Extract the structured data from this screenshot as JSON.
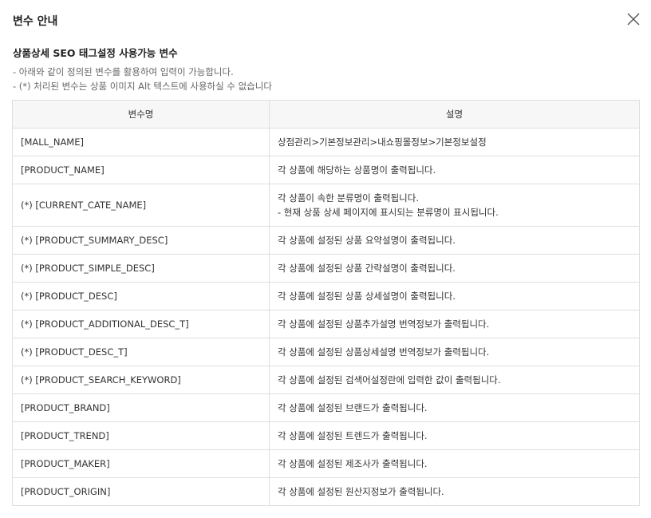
{
  "dialog": {
    "title": "변수 안내",
    "close_label": "닫기"
  },
  "section": {
    "title": "상품상세 SEO 태그설정 사용가능 변수",
    "notes": [
      "- 아래와 같이 정의된 변수를 활용하여 입력이 가능합니다.",
      "- (*) 처리된 변수는 상품 이미지 Alt 텍스트에 사용하실 수 없습니다"
    ]
  },
  "table": {
    "headers": [
      "변수명",
      "설명"
    ],
    "rows": [
      {
        "name": "[MALL_NAME]",
        "desc": [
          "상점관리>기본정보관리>내쇼핑몰정보>기본정보설정"
        ]
      },
      {
        "name": "[PRODUCT_NAME]",
        "desc": [
          "각 상품에 해당하는 상품명이 출력됩니다."
        ]
      },
      {
        "name": "(*) [CURRENT_CATE_NAME]",
        "desc": [
          "각 상품이 속한 분류명이 출력됩니다.",
          "- 현재 상품 상세 페이지에 표시되는 분류명이 표시됩니다."
        ]
      },
      {
        "name": "(*) [PRODUCT_SUMMARY_DESC]",
        "desc": [
          "각 상품에 설정된 상품 요약설명이 출력됩니다."
        ]
      },
      {
        "name": "(*) [PRODUCT_SIMPLE_DESC]",
        "desc": [
          "각 상품에 설정된 상품 간략설명이 출력됩니다."
        ]
      },
      {
        "name": "(*) [PRODUCT_DESC]",
        "desc": [
          "각 상품에 설정된 상품 상세설명이 출력됩니다."
        ]
      },
      {
        "name": "(*) [PRODUCT_ADDITIONAL_DESC_T]",
        "desc": [
          "각 상품에 설정된 상품추가설명 번역정보가 출력됩니다."
        ]
      },
      {
        "name": "(*) [PRODUCT_DESC_T]",
        "desc": [
          "각 상품에 설정된 상품상세설명 번역정보가 출력됩니다."
        ]
      },
      {
        "name": "(*) [PRODUCT_SEARCH_KEYWORD]",
        "desc": [
          "각 상품에 설정된 검색어설정란에 입력한 값이 출력됩니다."
        ]
      },
      {
        "name": "[PRODUCT_BRAND]",
        "desc": [
          "각 상품에 설정된 브랜드가 출력됩니다."
        ]
      },
      {
        "name": "[PRODUCT_TREND]",
        "desc": [
          "각 상품에 설정된 트렌드가 출력됩니다."
        ]
      },
      {
        "name": "[PRODUCT_MAKER]",
        "desc": [
          "각 상품에 설정된 제조사가 출력됩니다."
        ]
      },
      {
        "name": "[PRODUCT_ORIGIN]",
        "desc": [
          "각 상품에 설정된 원산지정보가 출력됩니다."
        ]
      }
    ]
  },
  "colors": {
    "border": "#dedede",
    "header_bg": "#f7f7f7",
    "note_text": "#666666"
  },
  "icons": {
    "close": "close-icon"
  }
}
